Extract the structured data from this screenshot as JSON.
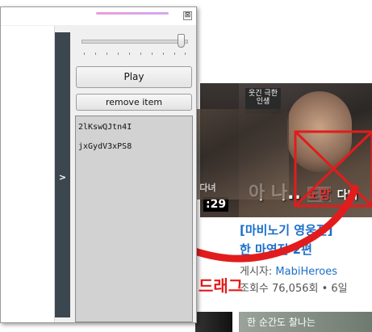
{
  "window": {
    "close_glyph": "⊠"
  },
  "side_toggle": {
    "label": ">"
  },
  "controls": {
    "play_label": "Play",
    "remove_label": "remove item",
    "volume_level": 0.95
  },
  "playlist": {
    "items": [
      "2lKswQJtn4I",
      "jxGydV3xPS8"
    ]
  },
  "video": {
    "badge_text": "웃긴\n극한인생",
    "caption_text": "아 나..",
    "caption_highlight": "도망",
    "caption_tail": "다녀",
    "duration": ":29",
    "title_line1": "[마비노기 영웅전]",
    "title_line2": "한 마영전 2편",
    "author_prefix": "게시자: ",
    "author": "MabiHeroes",
    "meta": "조회수 76,056회 • 6일"
  },
  "bottom_video": {
    "caption": "한 순간도 찰나는"
  },
  "annotation": {
    "drag_label": "드래그",
    "accent_color": "#e21c1c"
  }
}
